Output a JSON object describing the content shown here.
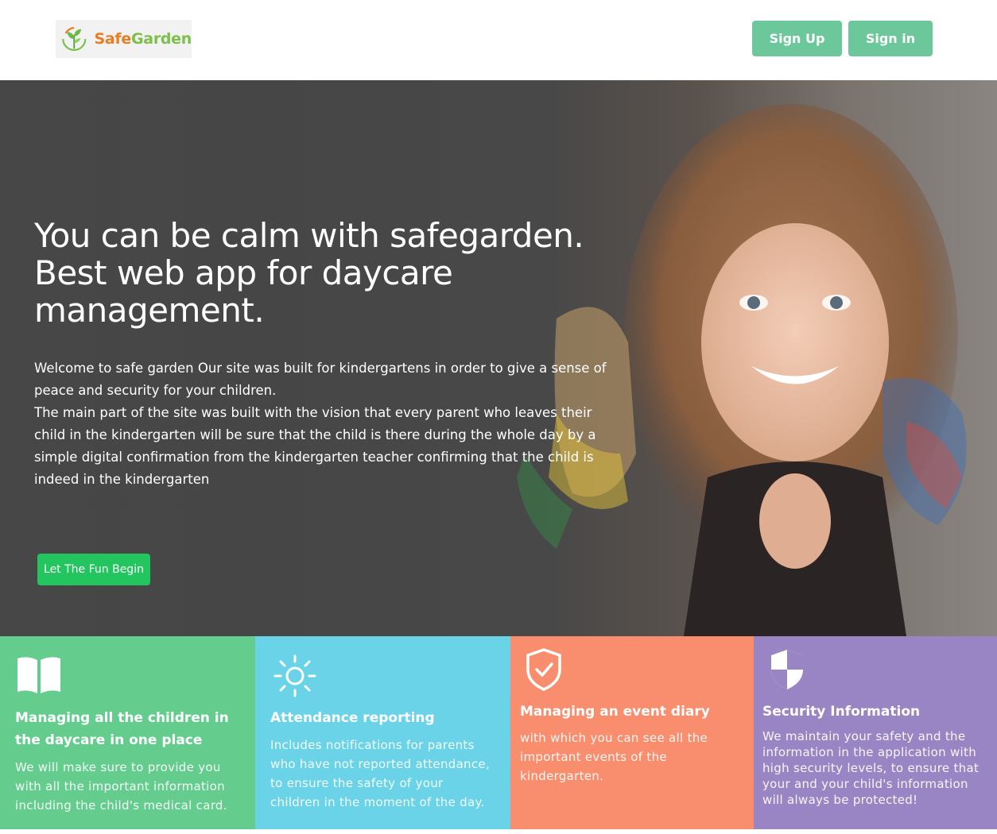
{
  "header": {
    "logo": {
      "part1": "Safe",
      "part2": "Garden"
    },
    "signup_label": "Sign Up",
    "signin_label": "Sign in"
  },
  "hero": {
    "title": "You can be calm with safegarden. Best web app for daycare management.",
    "paragraph1": "Welcome to safe garden Our site was built for kindergartens in order to give a sense of peace and security for your children.",
    "paragraph2": "The main part of the site was built with the vision that every parent who leaves their child in the kindergarten will be sure that the child is there during the whole day by a simple digital confirmation from the kindergarten teacher confirming that the child is indeed in the kindergarten",
    "cta_label": "Let The Fun Begin"
  },
  "features": [
    {
      "icon": "book-icon",
      "title": "Managing all the children in the daycare in one place",
      "text": "We will make sure to provide you with all the important information including the child's medical card.",
      "color": "#64cd8e"
    },
    {
      "icon": "sun-icon",
      "title": "Attendance reporting",
      "text": "Includes notifications for parents who have not reported attendance, to ensure the safety of your children in the moment of the day.",
      "color": "#6ad3e8"
    },
    {
      "icon": "shield-check-icon",
      "title": "Managing an event diary",
      "text": "with which you can see all the important events of the kindergarten.",
      "color": "#f98e6e"
    },
    {
      "icon": "shield-half-icon",
      "title": "Security Information",
      "text": "We maintain your safety and the information in the application with high security levels, to ensure that your and your child's information will always be protected!",
      "color": "#9a85c4"
    }
  ]
}
